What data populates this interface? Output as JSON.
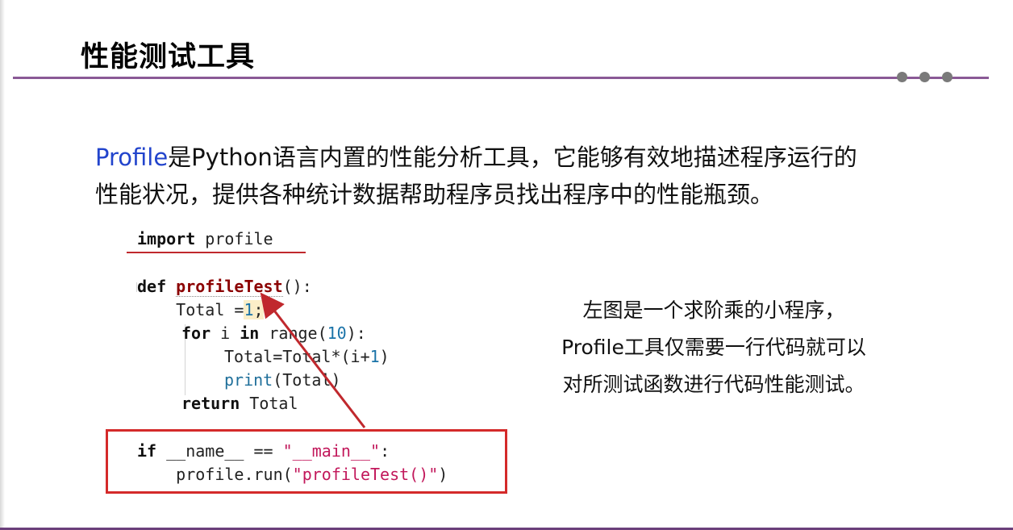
{
  "slide": {
    "title": "性能测试工具",
    "intro": {
      "highlight": "Profile",
      "line1_rest": "是Python语言内置的性能分析工具，它能够有效地描述程序运行的",
      "line2": "性能状况，提供各种统计数据帮助程序员找出程序中的性能瓶颈。"
    },
    "code": {
      "l1_kw": "import",
      "l1_rest": " profile",
      "l2_kw": "def",
      "l2_fn": "profileTest",
      "l2_rest": "():",
      "l3_a": "    Total =",
      "l3_num": "1",
      "l3_b": ";",
      "l4_kw1": "for",
      "l4_a": " i ",
      "l4_kw2": "in",
      "l4_b": " range(",
      "l4_num": "10",
      "l4_c": "):",
      "l5_a": "Total=Total*(i+",
      "l5_num": "1",
      "l5_b": ")",
      "l6_builtin": "print",
      "l6_rest": "(Total)",
      "l7_kw": "return",
      "l7_rest": " Total",
      "l8_kw": "if",
      "l8_a": " __name__ == ",
      "l8_str": "\"__main__\"",
      "l8_b": ":",
      "l9_a": "    profile.run(",
      "l9_str": "\"profileTest()\"",
      "l9_b": ")"
    },
    "note": {
      "line1": "左图是一个求阶乘的小程序，",
      "line2": "Profile工具仅需要一行代码就可以",
      "line3": "对所测试函数进行代码性能测试。"
    },
    "colors": {
      "accent_rule": "#8a5a96",
      "highlight": "#2244cc",
      "annotation_red": "#d42a2a"
    }
  }
}
